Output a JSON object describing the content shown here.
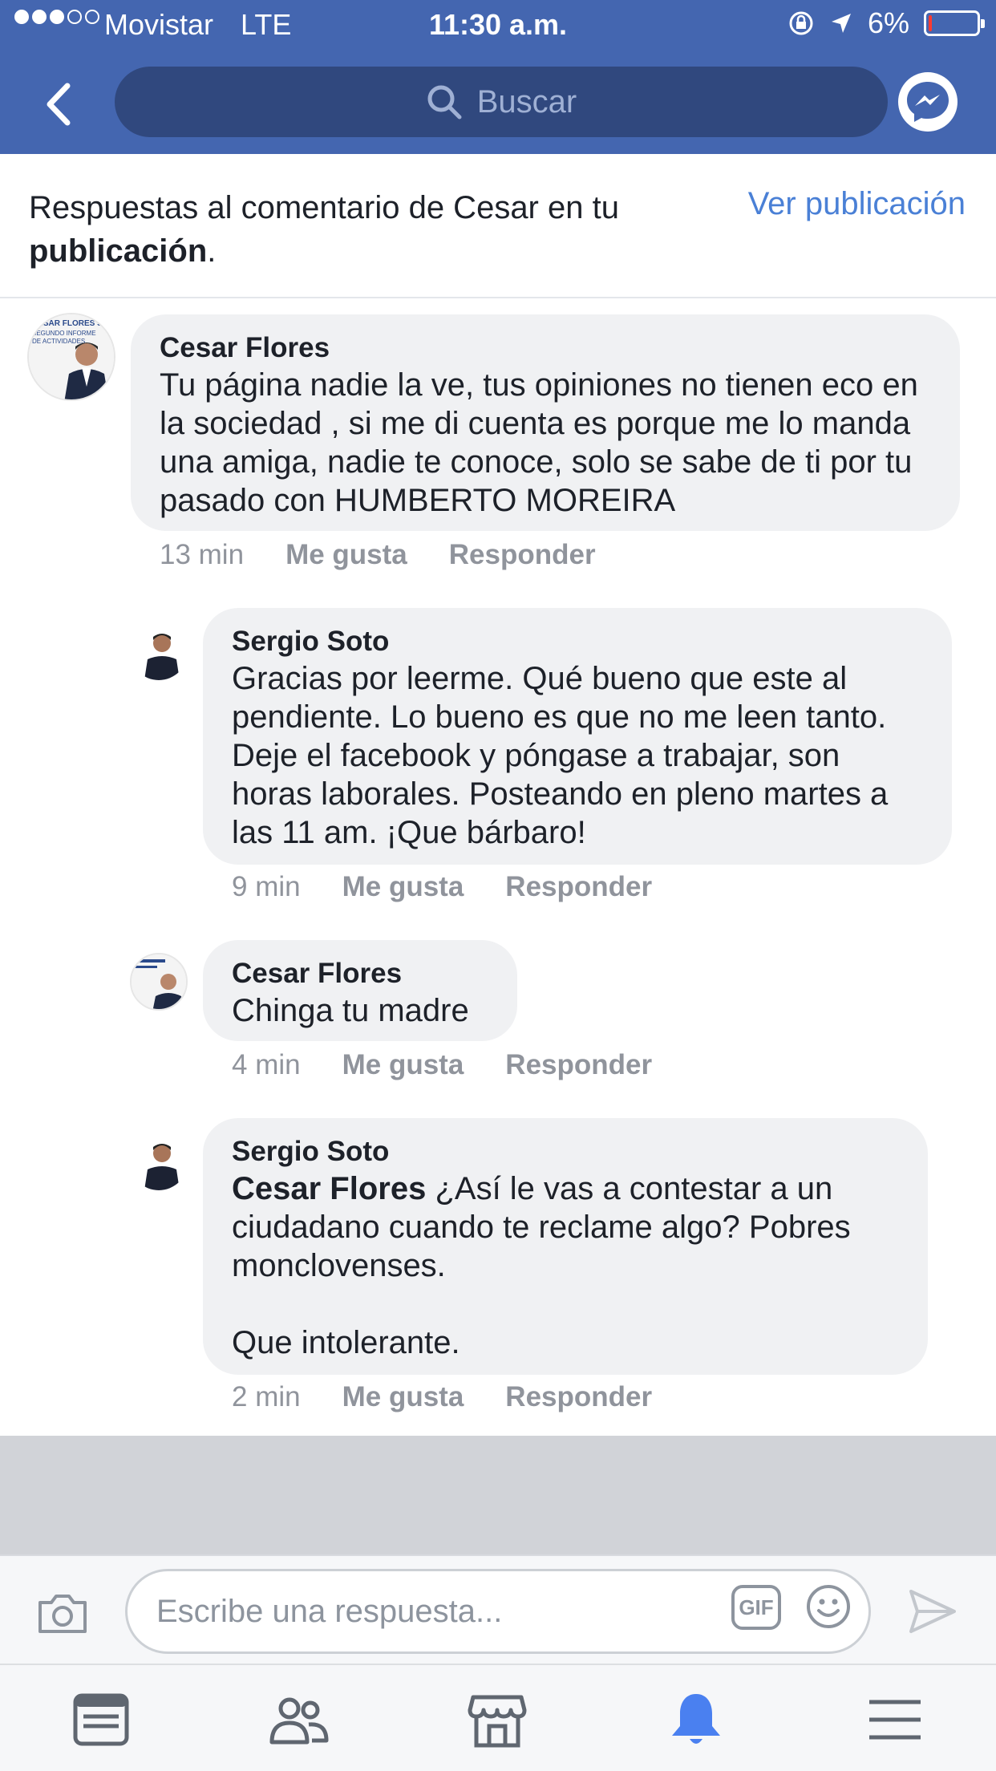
{
  "status_bar": {
    "carrier": "Movistar",
    "network": "LTE",
    "time": "11:30 a.m.",
    "battery": "6%",
    "battery_level": 0.06,
    "signal_bars": 3,
    "battery_color": "#ff3b30"
  },
  "nav": {
    "search_placeholder": "Buscar",
    "bar_color": "#4466b0"
  },
  "header": {
    "description_prefix": "Respuestas al comentario de Cesar en tu",
    "description_bold": "publicación",
    "description_suffix": ".",
    "view_post": "Ver publicación",
    "link_color": "#4a80d6"
  },
  "comments": [
    {
      "author": "Cesar Flores",
      "text": "Tu página nadie la ve, tus opiniones no tienen eco en la sociedad , si me di cuenta es porque me lo manda una amiga, nadie te conoce, solo se sabe de ti por tu pasado con HUMBERTO MOREIRA",
      "time": "13 min",
      "like": "Me gusta",
      "reply": "Responder",
      "avatar_text": "CESAR FLORES SOL\nSEGUNDO INFORME\nDE ACTIVIDADES"
    },
    {
      "author": "Sergio Soto",
      "text": "Gracias por leerme. Qué bueno que este al pendiente. Lo bueno es que no me leen tanto. Deje el facebook y póngase a trabajar, son horas laborales. Posteando en pleno martes a las 11 am. ¡Que bárbaro!",
      "time": "9 min",
      "like": "Me gusta",
      "reply": "Responder"
    },
    {
      "author": "Cesar Flores",
      "text": "Chinga tu madre",
      "time": "4 min",
      "like": "Me gusta",
      "reply": "Responder"
    },
    {
      "author": "Sergio Soto",
      "mention": "Cesar Flores",
      "text": " ¿Así le vas a contestar a un ciudadano cuando te reclame algo? Pobres monclovenses.\n\nQue intolerante.",
      "time": "2 min",
      "like": "Me gusta",
      "reply": "Responder"
    }
  ],
  "reply_bar": {
    "placeholder": "Escribe una respuesta...",
    "gif_label": "GIF"
  },
  "tabbar": {
    "tabs": [
      "news-feed-icon",
      "friends-icon",
      "marketplace-icon",
      "notifications-icon",
      "menu-icon"
    ],
    "active": "notifications-icon",
    "active_color": "#4a80f0",
    "inactive_color": "#5f6670"
  }
}
